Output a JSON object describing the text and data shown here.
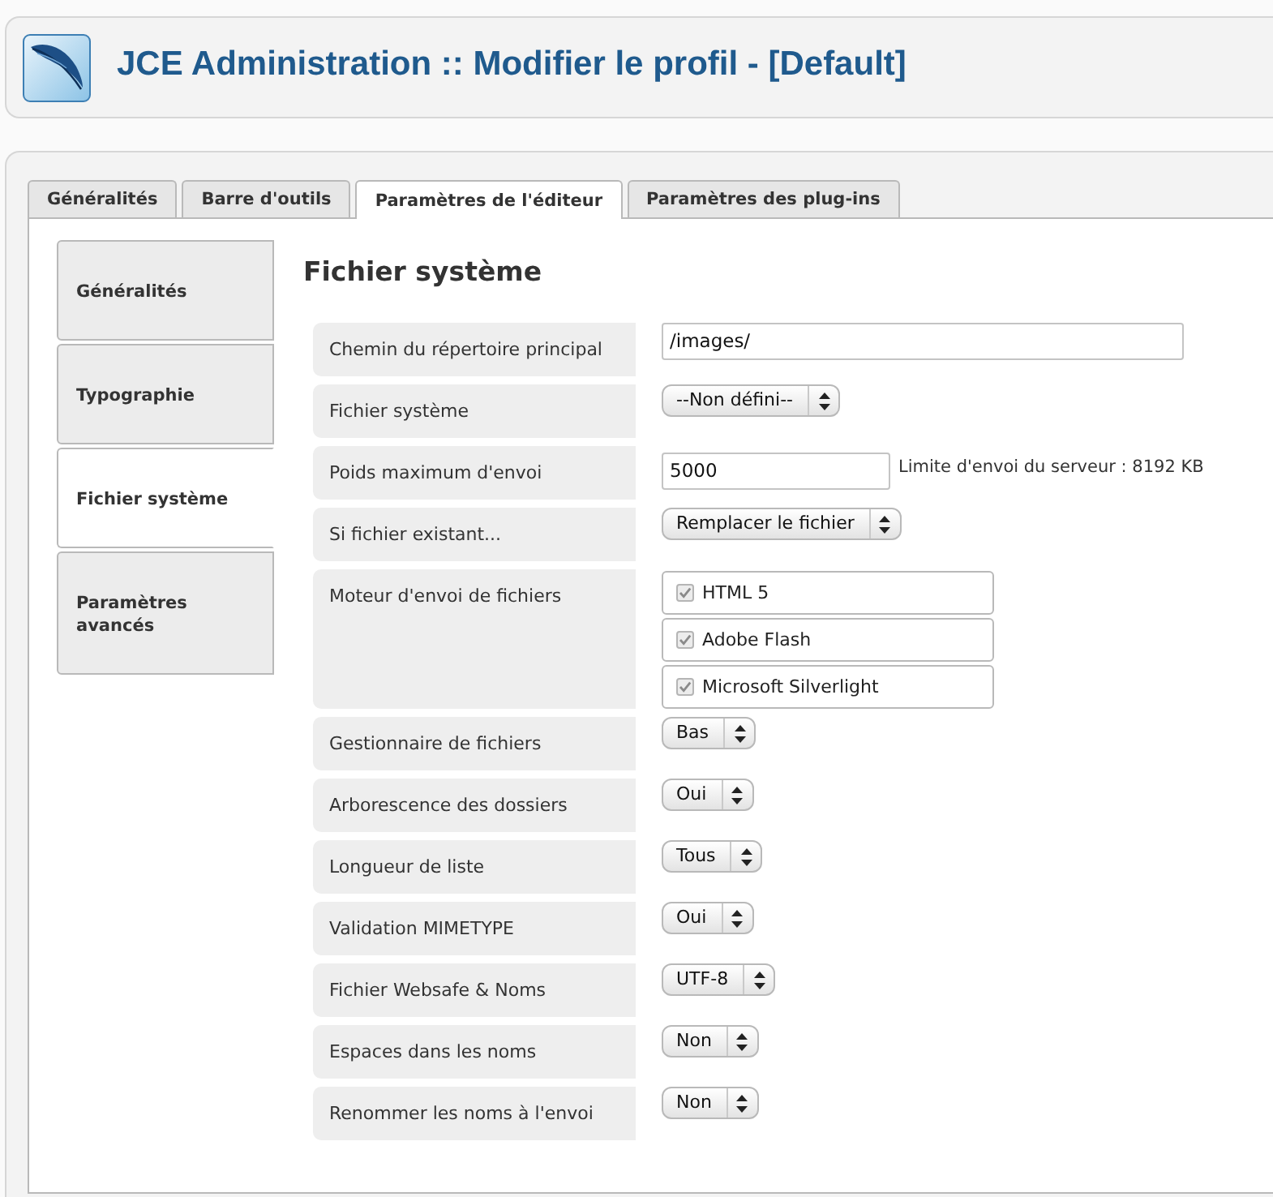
{
  "header": {
    "title": "JCE Administration :: Modifier le profil - [Default]"
  },
  "tabs": [
    {
      "label": "Généralités",
      "selected": false
    },
    {
      "label": "Barre d'outils",
      "selected": false
    },
    {
      "label": "Paramètres de l'éditeur",
      "selected": true
    },
    {
      "label": "Paramètres des plug-ins",
      "selected": false
    }
  ],
  "side_tabs": [
    {
      "label": "Généralités",
      "selected": false
    },
    {
      "label": "Typographie",
      "selected": false
    },
    {
      "label": "Fichier système",
      "selected": true
    },
    {
      "label": "Paramètres avancés",
      "selected": false
    }
  ],
  "section": {
    "title": "Fichier système"
  },
  "settings": [
    {
      "kind": "text",
      "label": "Chemin du répertoire principal",
      "value": "/images/"
    },
    {
      "kind": "select",
      "label": "Fichier système",
      "value": "--Non défini--"
    },
    {
      "kind": "text",
      "label": "Poids maximum d'envoi",
      "value": "5000",
      "note": "Limite d'envoi du serveur : 8192 KB"
    },
    {
      "kind": "select",
      "label": "Si fichier existant...",
      "value": "Remplacer le fichier"
    },
    {
      "kind": "checklist",
      "label": "Moteur d'envoi de fichiers",
      "options": [
        {
          "label": "HTML 5",
          "checked": true
        },
        {
          "label": "Adobe Flash",
          "checked": true
        },
        {
          "label": "Microsoft Silverlight",
          "checked": true
        }
      ]
    },
    {
      "kind": "select",
      "label": "Gestionnaire de fichiers",
      "value": "Bas"
    },
    {
      "kind": "select",
      "label": "Arborescence des dossiers",
      "value": "Oui"
    },
    {
      "kind": "select",
      "label": "Longueur de liste",
      "value": "Tous"
    },
    {
      "kind": "select",
      "label": "Validation MIMETYPE",
      "value": "Oui"
    },
    {
      "kind": "select",
      "label": "Fichier Websafe & Noms",
      "value": "UTF-8"
    },
    {
      "kind": "select",
      "label": "Espaces dans les noms",
      "value": "Non"
    },
    {
      "kind": "select",
      "label": "Renommer les noms à l'envoi",
      "value": "Non"
    }
  ]
}
